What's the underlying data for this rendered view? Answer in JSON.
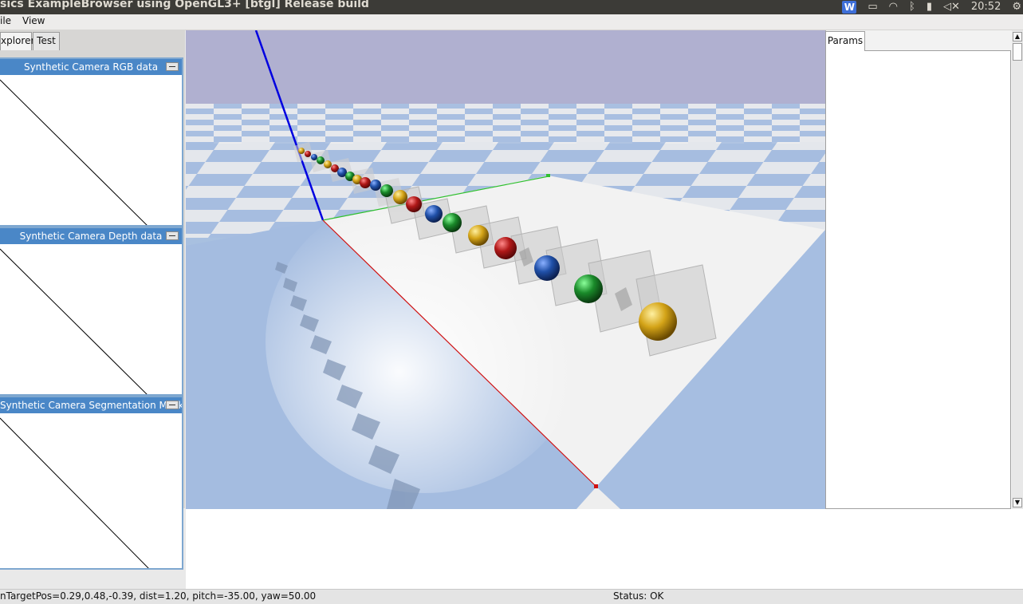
{
  "window": {
    "title": "sics ExampleBrowser using OpenGL3+ [btgl] Release build"
  },
  "tray": {
    "w_badge": "W",
    "clock": "20:52"
  },
  "menu": {
    "file": "ile",
    "view": "View"
  },
  "tabs": {
    "explorer": "xplorer",
    "test": "Test"
  },
  "camera_windows": {
    "rgb": "Synthetic Camera RGB data",
    "depth": "Synthetic Camera Depth data",
    "segmentation": "Synthetic Camera Segmentation Mask"
  },
  "params": {
    "tab_label": "Params"
  },
  "status": {
    "camera_info": "nTargetPos=0.29,0.48,-0.39, dist=1.20, pitch=-35.00, yaw=50.00",
    "state": "Status: OK"
  },
  "colors": {
    "sky": "#b0b0d0",
    "floor_blue": "#a8c0e0",
    "floor_white": "#f0f0f0",
    "sphere_red": "#b01818",
    "sphere_blue": "#2050a8",
    "sphere_green": "#1a8a2a",
    "sphere_yellow": "#d4a418"
  }
}
